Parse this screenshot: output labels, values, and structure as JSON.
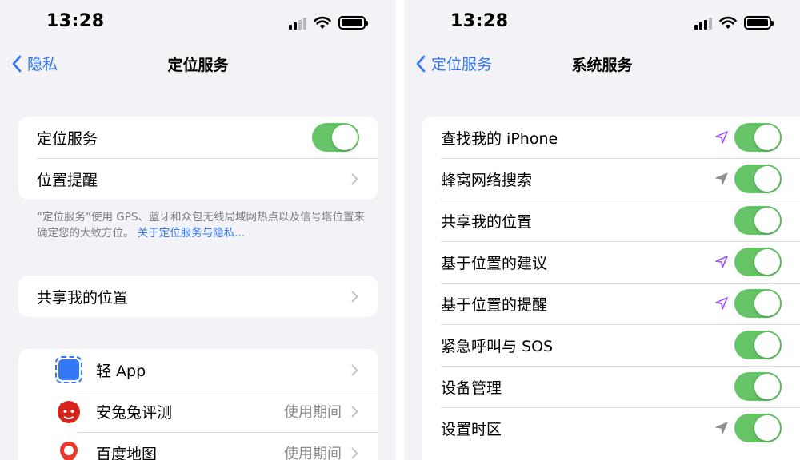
{
  "left": {
    "status_bar": {
      "time": "13:28"
    },
    "nav": {
      "back_label": "隐私",
      "title": "定位服务"
    },
    "group1": {
      "location_services_label": "定位服务",
      "location_services_on": true,
      "location_alerts_label": "位置提醒"
    },
    "footer": {
      "text": "“定位服务”使用 GPS、蓝牙和众包无线局域网热点以及信号塔位置来确定您的大致方位。",
      "link": "关于定位服务与隐私..."
    },
    "share_location_label": "共享我的位置",
    "apps": [
      {
        "name": "轻 App",
        "value": "",
        "icon": "blue-square-app-icon"
      },
      {
        "name": "安兔兔评测",
        "value": "使用期间",
        "icon": "antutu-app-icon"
      },
      {
        "name": "百度地图",
        "value": "使用期间",
        "icon": "baidu-maps-app-icon"
      }
    ]
  },
  "right": {
    "status_bar": {
      "time": "13:28"
    },
    "nav": {
      "back_label": "定位服务",
      "title": "系统服务"
    },
    "items": [
      {
        "label": "查找我的 iPhone",
        "on": true,
        "arrow": "purple"
      },
      {
        "label": "蜂窝网络搜索",
        "on": true,
        "arrow": "gray"
      },
      {
        "label": "共享我的位置",
        "on": true,
        "arrow": "none"
      },
      {
        "label": "基于位置的建议",
        "on": true,
        "arrow": "purple"
      },
      {
        "label": "基于位置的提醒",
        "on": true,
        "arrow": "purple"
      },
      {
        "label": "紧急呼叫与 SOS",
        "on": true,
        "arrow": "none"
      },
      {
        "label": "设备管理",
        "on": true,
        "arrow": "none"
      },
      {
        "label": "设置时区",
        "on": true,
        "arrow": "gray"
      }
    ]
  },
  "colors": {
    "accent": "#3478f6",
    "toggle_on": "#65c466",
    "arrow_purple": "#a05cf0",
    "arrow_gray": "#8e8e93",
    "background": "#f2f2f7"
  }
}
